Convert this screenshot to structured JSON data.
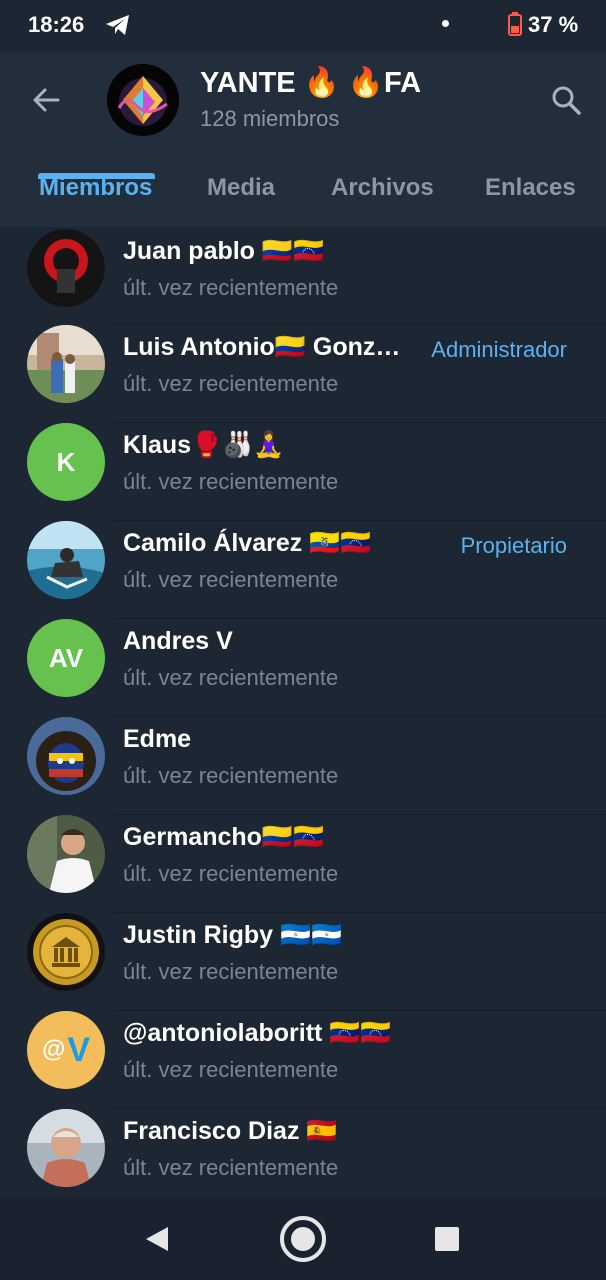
{
  "status_bar": {
    "time": "18:26",
    "battery": "37 %"
  },
  "header": {
    "title": "YANTE 🔥 🔥FA",
    "subtitle": "128 miembros",
    "icons": {
      "back": "arrow-left-icon",
      "search": "search-icon"
    }
  },
  "tabs": [
    {
      "label": "Miembros",
      "active": true
    },
    {
      "label": "Media",
      "active": false
    },
    {
      "label": "Archivos",
      "active": false
    },
    {
      "label": "Enlaces",
      "active": false
    }
  ],
  "members": [
    {
      "name": "Juan pablo 🇨🇴🇻🇪",
      "status": "últ. vez recientemente",
      "role": "",
      "avatar_letter": "",
      "avatar_color": "#1a1a1a"
    },
    {
      "name": "Luis Antonio🇨🇴 Gonz…",
      "status": "últ. vez recientemente",
      "role": "Administrador",
      "avatar_letter": "",
      "avatar_color": "#7a9b8c"
    },
    {
      "name": "Klaus🥊🎳🧘‍♀️",
      "status": "últ. vez recientemente",
      "role": "",
      "avatar_letter": "K",
      "avatar_color": "#66c14f"
    },
    {
      "name": "Camilo Álvarez 🇪🇨🇻🇪",
      "status": "últ. vez recientemente",
      "role": "Propietario",
      "avatar_letter": "",
      "avatar_color": "#4a9ab5"
    },
    {
      "name": "Andres V",
      "status": "últ. vez recientemente",
      "role": "",
      "avatar_letter": "AV",
      "avatar_color": "#66c14f"
    },
    {
      "name": "Edme",
      "status": "últ. vez recientemente",
      "role": "",
      "avatar_letter": "",
      "avatar_color": "#2c3a66"
    },
    {
      "name": "Germancho🇨🇴🇻🇪",
      "status": "últ. vez recientemente",
      "role": "",
      "avatar_letter": "",
      "avatar_color": "#3d4a3a"
    },
    {
      "name": "Justin Rigby 🇳🇮🇳🇮",
      "status": "últ. vez recientemente",
      "role": "",
      "avatar_letter": "",
      "avatar_color": "#b58a1e"
    },
    {
      "name": "@antoniolaboritt 🇻🇪🇻🇪",
      "status": "últ. vez recientemente",
      "role": "",
      "avatar_letter": "@V",
      "avatar_color": "#f2bd5a"
    },
    {
      "name": "Francisco Diaz 🇪🇸",
      "status": "últ. vez recientemente",
      "role": "",
      "avatar_letter": "",
      "avatar_color": "#8e8578"
    }
  ],
  "colors": {
    "accent": "#5ab2f1",
    "background": "#1d2733",
    "header": "#232e3c",
    "secondary_text": "#7b8590"
  }
}
